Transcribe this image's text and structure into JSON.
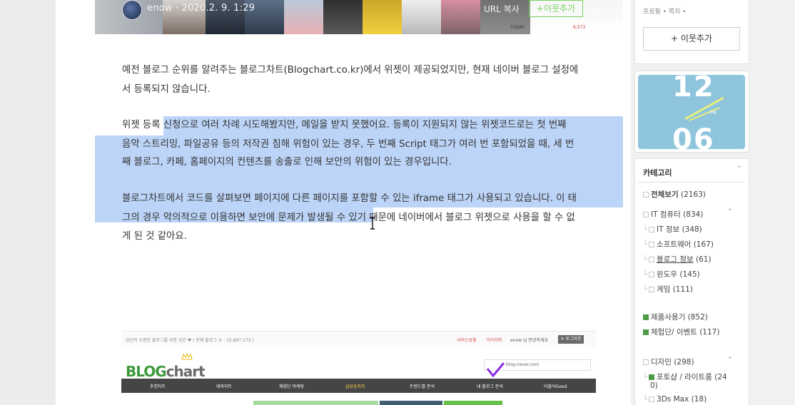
{
  "post_header": {
    "author": "enow · 2020.2. 9. 1:29",
    "url_copy_label": "URL 복사",
    "add_neighbor_label": "+이웃추가",
    "more_icon": "⋮",
    "today_label": "TODAY",
    "today_value": "6,573"
  },
  "article": {
    "p1_line1": "예전 블로그 순위를 알려주는 블로그차트(Blogchart.co.kr)에서 위젯이 제공되었지만, 현재 네이버 블로그 설정에",
    "p1_line2": "서 등록되지 않습니다.",
    "p2_line1": "위젯 등록 신청으로 여러 차례 시도해봤지만, 메일을 받지 못했어요. 등록이 지원되지 않는 위젯코드로는 첫 번째",
    "p2_line2": "음악 스트리밍, 파일공유 등의 저작권 침해 위험이 있는 경우, 두 번째 Script 태그가 여러 번 포함되었을 때, 세 번",
    "p2_line3": "째 블로그, 카페, 홈페이지의 컨텐츠를 송출로 인해 보안의 위험이 있는 경우입니다.",
    "p3_line1": "블로그차트에서 코드를  살펴보면 페이지에 다른 페이지를 포함할 수 있는 iframe 태그가 사용되고 있습니다. 이 태",
    "p3_line2": "그의 경우 악의적으로 이용하면 보안에 문제가 발생될 수 있기 때문에 네이버에서 블로그 위젯으로 사용을 할 수 없",
    "p3_line3": "게 된 것 같아요."
  },
  "embed": {
    "tagline": "당신의 소중한 블로그를 위한 공간 ♥  ( 전체 블로그 수 : 15,897,173 )",
    "services": "서비스상품",
    "mypage": "마이차트",
    "user": "enow 님 안녕하세요",
    "logout": "✕ 로그아웃",
    "logo_green": "BLOG",
    "logo_gray": "chart",
    "blog_name": "blog.naver.com",
    "nav": [
      "추천차트",
      "테마차트",
      "체험단 마케팅",
      "급상승차트",
      "트렌드별 분석",
      "내 블로그 분석",
      "더블어Good"
    ],
    "colors": {
      "brand_green": "#3d9a3c",
      "nav_bg": "#454545",
      "accent_red": "#d24b4b"
    }
  },
  "sidebar": {
    "profile_meta": "프로필 • 쪽지 •",
    "add_neighbor_label": "+ 이웃추가",
    "clock": {
      "hour": "12",
      "minute": "06",
      "ampm": "PM"
    },
    "category_title": "카테고리",
    "categories": [
      {
        "label": "전체보기",
        "count": "(2163)"
      },
      {
        "label": "IT 컴퓨터",
        "count": "(834)"
      },
      {
        "label": "IT 정보",
        "count": "(348)"
      },
      {
        "label": "소프트웨어",
        "count": "(167)"
      },
      {
        "label": "블로그 정보",
        "count": "(61)"
      },
      {
        "label": "윈도우",
        "count": "(145)"
      },
      {
        "label": "게임",
        "count": "(111)"
      },
      {
        "label": "제품사용기",
        "count": "(852)"
      },
      {
        "label": "체험단/ 이벤트",
        "count": "(117)"
      },
      {
        "label": "디자인",
        "count": "(298)"
      },
      {
        "label": "포토샵 / 라이트룸",
        "count": "(24"
      },
      {
        "label": "0)",
        "count": ""
      },
      {
        "label": "3Ds Max",
        "count": "(18)"
      }
    ]
  }
}
